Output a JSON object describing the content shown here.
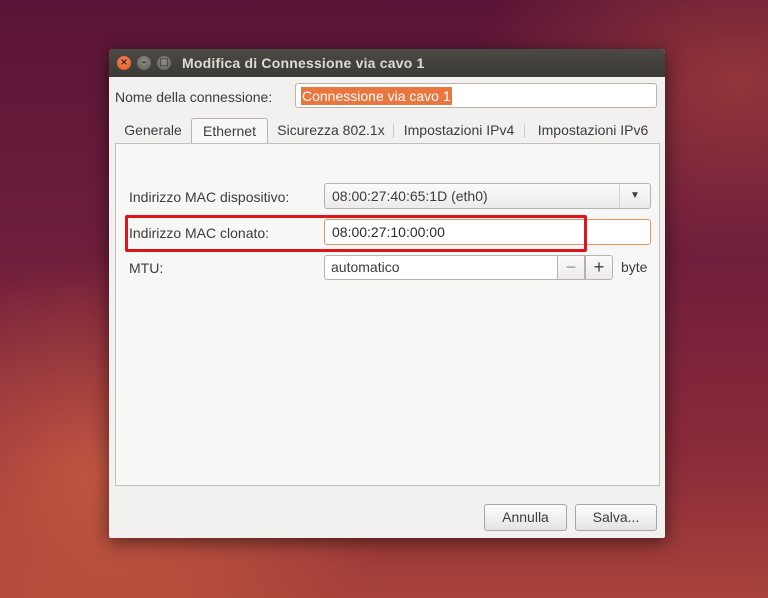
{
  "window": {
    "title": "Modifica di Connessione via cavo 1",
    "controls": {
      "close_glyph": "×",
      "minimize_glyph": "–",
      "maximize_glyph": "□"
    }
  },
  "connection_name": {
    "label": "Nome della connessione:",
    "value": "Connessione via cavo 1"
  },
  "tabs": [
    {
      "label": "Generale"
    },
    {
      "label": "Ethernet",
      "active": true
    },
    {
      "label": "Sicurezza 802.1x"
    },
    {
      "label": "Impostazioni IPv4"
    },
    {
      "label": "Impostazioni IPv6"
    }
  ],
  "ethernet": {
    "device_mac": {
      "label": "Indirizzo MAC dispositivo:",
      "value": "08:00:27:40:65:1D (eth0)",
      "dropdown_icon": "chevron-down-icon"
    },
    "cloned_mac": {
      "label": "Indirizzo MAC clonato:",
      "value": "08:00:27:10:00:00"
    },
    "mtu": {
      "label": "MTU:",
      "value": "automatico",
      "minus": "−",
      "plus": "+",
      "unit": "byte"
    }
  },
  "buttons": {
    "cancel": "Annulla",
    "save": "Salva..."
  },
  "colors": {
    "accent": "#e9753f",
    "highlight_box": "#e0141b",
    "titlebar": "#3e3d39"
  }
}
